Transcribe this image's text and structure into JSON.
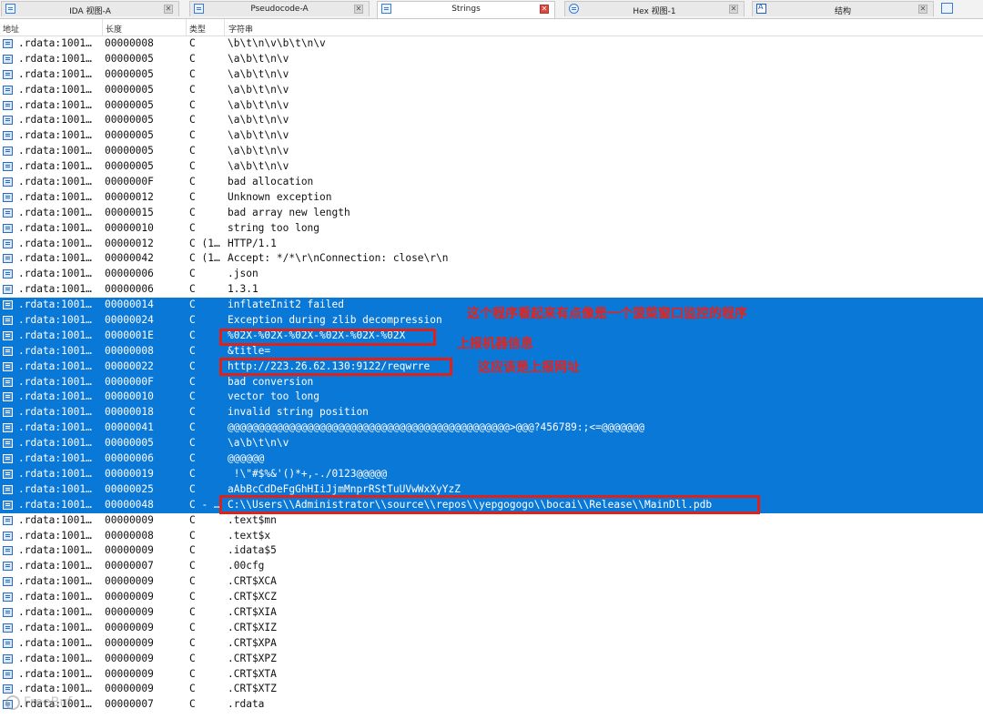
{
  "tabs": [
    {
      "label": "IDA 视图-A",
      "icon": "ida-view-icon"
    },
    {
      "label": "Pseudocode-A",
      "icon": "pseudocode-icon"
    },
    {
      "label": "Strings",
      "icon": "strings-icon",
      "active": true
    },
    {
      "label": "Hex 视图-1",
      "icon": "hex-view-icon"
    },
    {
      "label": "结构",
      "icon": "structures-icon"
    }
  ],
  "tab_close_glyph": "✕",
  "columns": {
    "address": "地址",
    "length": "长度",
    "type": "类型",
    "string": "字符串"
  },
  "rows": [
    {
      "addr": ".rdata:1001…",
      "len": "00000008",
      "type": "C",
      "str": "\\b\\t\\n\\v\\b\\t\\n\\v",
      "sel": false
    },
    {
      "addr": ".rdata:1001…",
      "len": "00000005",
      "type": "C",
      "str": "\\a\\b\\t\\n\\v",
      "sel": false
    },
    {
      "addr": ".rdata:1001…",
      "len": "00000005",
      "type": "C",
      "str": "\\a\\b\\t\\n\\v",
      "sel": false
    },
    {
      "addr": ".rdata:1001…",
      "len": "00000005",
      "type": "C",
      "str": "\\a\\b\\t\\n\\v",
      "sel": false
    },
    {
      "addr": ".rdata:1001…",
      "len": "00000005",
      "type": "C",
      "str": "\\a\\b\\t\\n\\v",
      "sel": false
    },
    {
      "addr": ".rdata:1001…",
      "len": "00000005",
      "type": "C",
      "str": "\\a\\b\\t\\n\\v",
      "sel": false
    },
    {
      "addr": ".rdata:1001…",
      "len": "00000005",
      "type": "C",
      "str": "\\a\\b\\t\\n\\v",
      "sel": false
    },
    {
      "addr": ".rdata:1001…",
      "len": "00000005",
      "type": "C",
      "str": "\\a\\b\\t\\n\\v",
      "sel": false
    },
    {
      "addr": ".rdata:1001…",
      "len": "00000005",
      "type": "C",
      "str": "\\a\\b\\t\\n\\v",
      "sel": false
    },
    {
      "addr": ".rdata:1001…",
      "len": "0000000F",
      "type": "C",
      "str": "bad allocation",
      "sel": false
    },
    {
      "addr": ".rdata:1001…",
      "len": "00000012",
      "type": "C",
      "str": "Unknown exception",
      "sel": false
    },
    {
      "addr": ".rdata:1001…",
      "len": "00000015",
      "type": "C",
      "str": "bad array new length",
      "sel": false
    },
    {
      "addr": ".rdata:1001…",
      "len": "00000010",
      "type": "C",
      "str": "string too long",
      "sel": false
    },
    {
      "addr": ".rdata:1001…",
      "len": "00000012",
      "type": "C (1…",
      "str": "HTTP/1.1",
      "sel": false
    },
    {
      "addr": ".rdata:1001…",
      "len": "00000042",
      "type": "C (1…",
      "str": "Accept: */*\\r\\nConnection: close\\r\\n",
      "sel": false
    },
    {
      "addr": ".rdata:1001…",
      "len": "00000006",
      "type": "C",
      "str": ".json",
      "sel": false
    },
    {
      "addr": ".rdata:1001…",
      "len": "00000006",
      "type": "C",
      "str": "1.3.1",
      "sel": false
    },
    {
      "addr": ".rdata:1001…",
      "len": "00000014",
      "type": "C",
      "str": "inflateInit2 failed",
      "sel": true
    },
    {
      "addr": ".rdata:1001…",
      "len": "00000024",
      "type": "C",
      "str": "Exception during zlib decompression",
      "sel": true
    },
    {
      "addr": ".rdata:1001…",
      "len": "0000001E",
      "type": "C",
      "str": "%02X-%02X-%02X-%02X-%02X-%02X",
      "sel": true
    },
    {
      "addr": ".rdata:1001…",
      "len": "00000008",
      "type": "C",
      "str": "&title=",
      "sel": true
    },
    {
      "addr": ".rdata:1001…",
      "len": "00000022",
      "type": "C",
      "str": "http://223.26.62.130:9122/reqwrre",
      "sel": true
    },
    {
      "addr": ".rdata:1001…",
      "len": "0000000F",
      "type": "C",
      "str": "bad conversion",
      "sel": true
    },
    {
      "addr": ".rdata:1001…",
      "len": "00000010",
      "type": "C",
      "str": "vector too long",
      "sel": true
    },
    {
      "addr": ".rdata:1001…",
      "len": "00000018",
      "type": "C",
      "str": "invalid string position",
      "sel": true
    },
    {
      "addr": ".rdata:1001…",
      "len": "00000041",
      "type": "C",
      "str": "@@@@@@@@@@@@@@@@@@@@@@@@@@@@@@@@@@@@@@@@@@@@@@>@@@?456789:;<=@@@@@@@",
      "sel": true
    },
    {
      "addr": ".rdata:1001…",
      "len": "00000005",
      "type": "C",
      "str": "\\a\\b\\t\\n\\v",
      "sel": true
    },
    {
      "addr": ".rdata:1001…",
      "len": "00000006",
      "type": "C",
      "str": "@@@@@@",
      "sel": true
    },
    {
      "addr": ".rdata:1001…",
      "len": "00000019",
      "type": "C",
      "str": " !\\\"#$%&'()*+,-./0123@@@@@",
      "sel": true
    },
    {
      "addr": ".rdata:1001…",
      "len": "00000025",
      "type": "C",
      "str": "aAbBcCdDeFgGhHIiJjmMnprRStTuUVwWxXyYzZ",
      "sel": true
    },
    {
      "addr": ".rdata:1001…",
      "len": "00000048",
      "type": "C - …",
      "str": "C:\\\\Users\\\\Administrator\\\\source\\\\repos\\\\yepgogogo\\\\bocai\\\\Release\\\\MainDll.pdb",
      "sel": true
    },
    {
      "addr": ".rdata:1001…",
      "len": "00000009",
      "type": "C",
      "str": ".text$mn",
      "sel": false
    },
    {
      "addr": ".rdata:1001…",
      "len": "00000008",
      "type": "C",
      "str": ".text$x",
      "sel": false
    },
    {
      "addr": ".rdata:1001…",
      "len": "00000009",
      "type": "C",
      "str": ".idata$5",
      "sel": false
    },
    {
      "addr": ".rdata:1001…",
      "len": "00000007",
      "type": "C",
      "str": ".00cfg",
      "sel": false
    },
    {
      "addr": ".rdata:1001…",
      "len": "00000009",
      "type": "C",
      "str": ".CRT$XCA",
      "sel": false
    },
    {
      "addr": ".rdata:1001…",
      "len": "00000009",
      "type": "C",
      "str": ".CRT$XCZ",
      "sel": false
    },
    {
      "addr": ".rdata:1001…",
      "len": "00000009",
      "type": "C",
      "str": ".CRT$XIA",
      "sel": false
    },
    {
      "addr": ".rdata:1001…",
      "len": "00000009",
      "type": "C",
      "str": ".CRT$XIZ",
      "sel": false
    },
    {
      "addr": ".rdata:1001…",
      "len": "00000009",
      "type": "C",
      "str": ".CRT$XPA",
      "sel": false
    },
    {
      "addr": ".rdata:1001…",
      "len": "00000009",
      "type": "C",
      "str": ".CRT$XPZ",
      "sel": false
    },
    {
      "addr": ".rdata:1001…",
      "len": "00000009",
      "type": "C",
      "str": ".CRT$XTA",
      "sel": false
    },
    {
      "addr": ".rdata:1001…",
      "len": "00000009",
      "type": "C",
      "str": ".CRT$XTZ",
      "sel": false
    },
    {
      "addr": ".rdata:1001…",
      "len": "00000007",
      "type": "C",
      "str": ".rdata",
      "sel": false
    }
  ],
  "annotations": {
    "note1": "这个程序看起来有点像是一个菠菜窗口监控的程序",
    "note2": "上报机器信息",
    "note3": "这应该是上报网址"
  },
  "colors": {
    "selection": "#0a78d7",
    "annotation": "#e0211a"
  },
  "watermark": "FreeBuf"
}
